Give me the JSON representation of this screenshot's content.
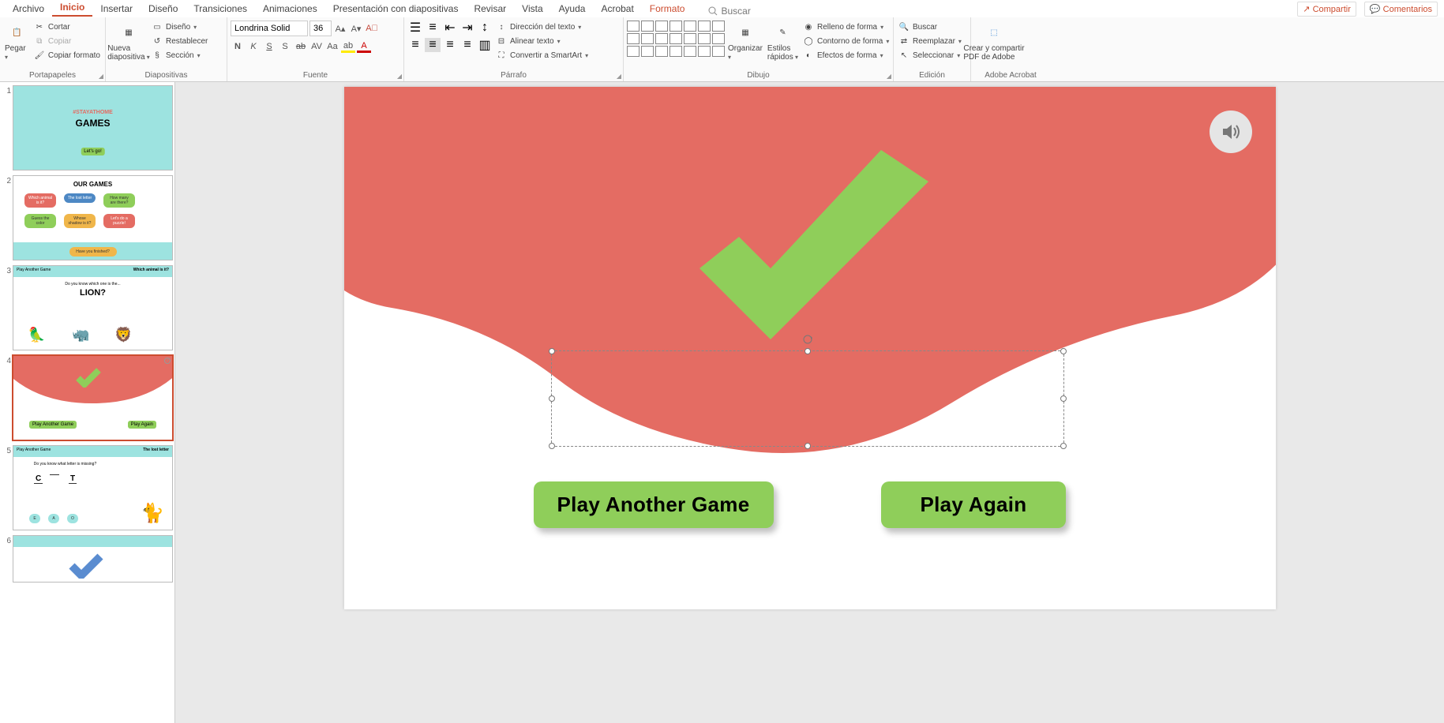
{
  "menu": {
    "tabs": [
      "Archivo",
      "Inicio",
      "Insertar",
      "Diseño",
      "Transiciones",
      "Animaciones",
      "Presentación con diapositivas",
      "Revisar",
      "Vista",
      "Ayuda",
      "Acrobat"
    ],
    "active": "Inicio",
    "format": "Formato",
    "search": "Buscar",
    "share": "Compartir",
    "comments": "Comentarios"
  },
  "ribbon": {
    "clipboard": {
      "label": "Portapapeles",
      "paste": "Pegar",
      "cut": "Cortar",
      "copy": "Copiar",
      "format_painter": "Copiar formato"
    },
    "slides": {
      "label": "Diapositivas",
      "new_slide": "Nueva\ndiapositiva",
      "layout": "Diseño",
      "reset": "Restablecer",
      "section": "Sección"
    },
    "font": {
      "label": "Fuente",
      "name": "Londrina Solid",
      "size": "36"
    },
    "paragraph": {
      "label": "Párrafo",
      "text_dir": "Dirección del texto",
      "align_text": "Alinear texto",
      "smartart": "Convertir a SmartArt"
    },
    "drawing": {
      "label": "Dibujo",
      "arrange": "Organizar",
      "styles": "Estilos\nrápidos",
      "fill": "Relleno de forma",
      "outline": "Contorno de forma",
      "effects": "Efectos de forma"
    },
    "editing": {
      "label": "Edición",
      "find": "Buscar",
      "replace": "Reemplazar",
      "select": "Seleccionar"
    },
    "acrobat": {
      "label": "Adobe Acrobat",
      "create": "Crear y compartir\nPDF de Adobe"
    }
  },
  "slide": {
    "btn1": "Play Another Game",
    "btn2": "Play Again"
  },
  "thumbs": {
    "t1_title": "#STAYATHOME",
    "t1_sub": "GAMES",
    "t1_btn": "Let's go!",
    "t2_title": "OUR GAMES",
    "t2_chips": [
      "Which animal is it?",
      "The lost letter",
      "How many are there?",
      "Guess the color",
      "Whose shadow is it?",
      "Let's do a puzzle!"
    ],
    "t2_foot": "Have you finished?",
    "t3_top": "Play Another Game",
    "t3_cat": "Which animal is it?",
    "t3_q": "Do you know which one is the...",
    "t3_a": "LION?",
    "t4_b1": "Play Another Game",
    "t4_b2": "Play Again",
    "t5_top": "Play Another Game",
    "t5_cat": "The lost letter",
    "t5_q": "Do you know what letter is missing?",
    "t5_word1": "C",
    "t5_word2": "T",
    "t5_opts": [
      "E",
      "A",
      "O"
    ]
  }
}
